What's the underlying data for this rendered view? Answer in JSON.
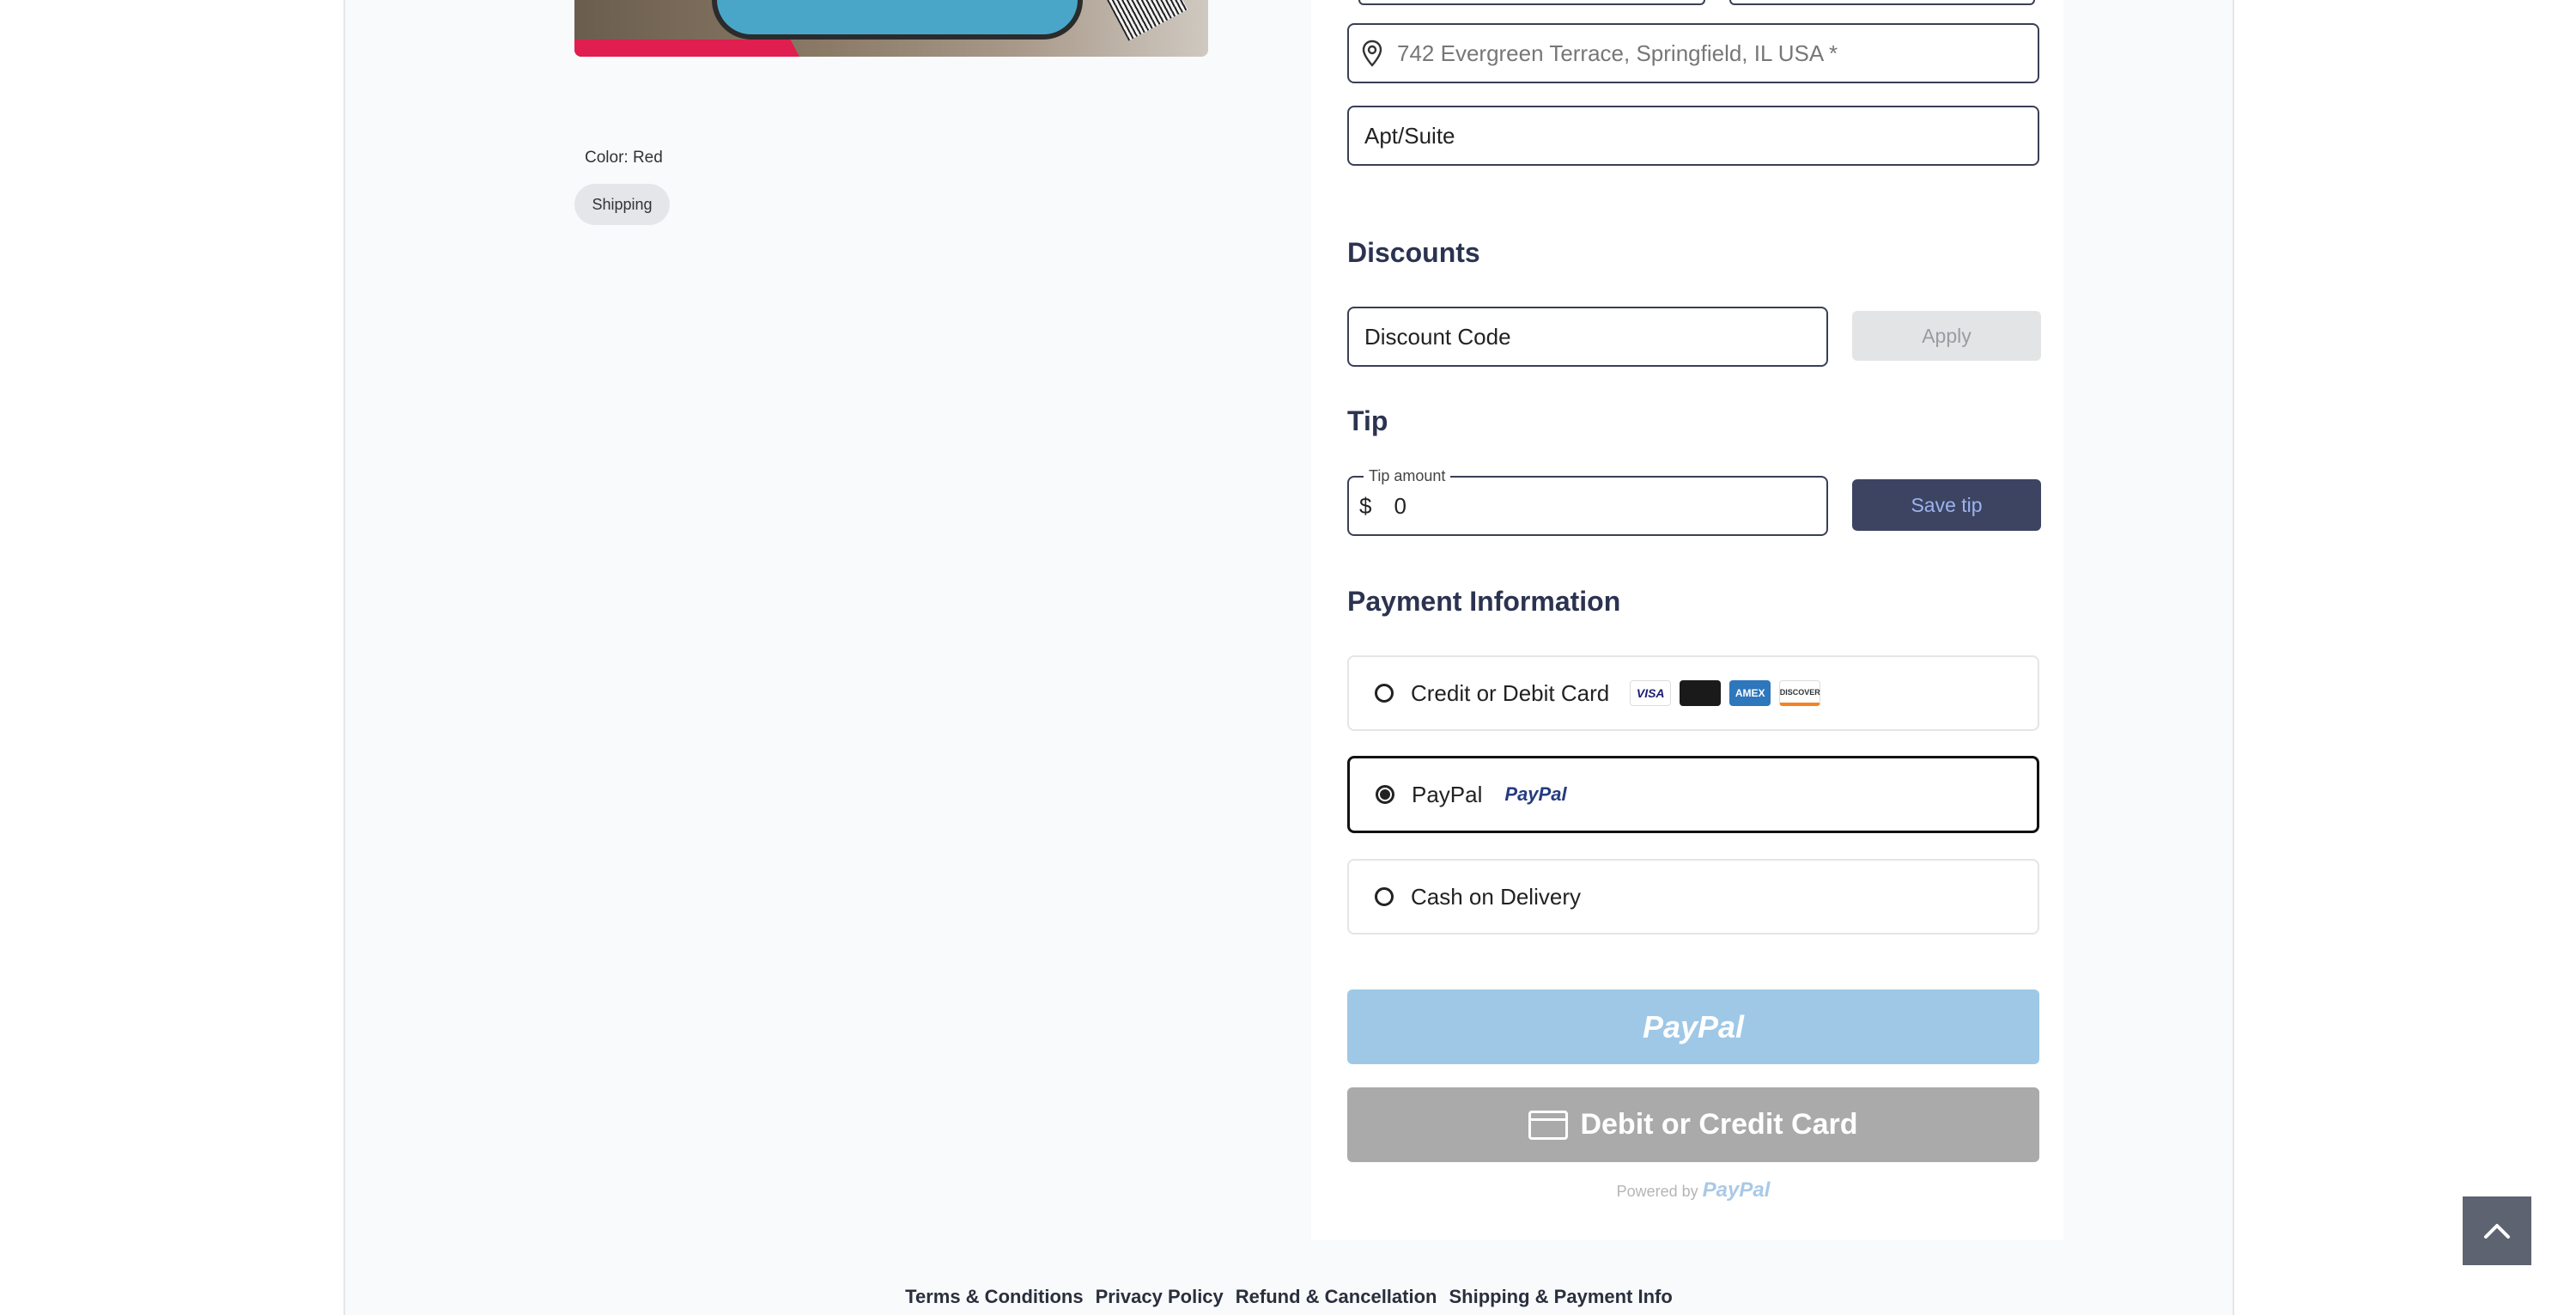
{
  "product": {
    "color_label": "Color: Red",
    "shipping_pill": "Shipping"
  },
  "address": {
    "street_placeholder": "742 Evergreen Terrace, Springfield, IL USA *",
    "apt_placeholder": "Apt/Suite"
  },
  "discounts": {
    "title": "Discounts",
    "code_placeholder": "Discount Code",
    "apply_label": "Apply"
  },
  "tip": {
    "title": "Tip",
    "field_label": "Tip amount",
    "currency": "$",
    "value": "0",
    "save_label": "Save tip"
  },
  "payment": {
    "title": "Payment Information",
    "options": [
      {
        "label": "Credit or Debit Card",
        "selected": false
      },
      {
        "label": "PayPal",
        "selected": true
      },
      {
        "label": "Cash on Delivery",
        "selected": false
      }
    ],
    "card_brands": [
      "VISA",
      "mastercard",
      "AMEX",
      "DISCOVER"
    ],
    "paypal_brand": "PayPal",
    "paypal_button_label": "PayPal",
    "card_button_label": "Debit or Credit Card",
    "powered_by": "Powered by",
    "powered_brand": "PayPal"
  },
  "footer": {
    "links": [
      "Terms & Conditions",
      "Privacy Policy",
      "Refund & Cancellation",
      "Shipping & Payment Info"
    ]
  },
  "colors": {
    "accent_dark": "#3c4461",
    "paypal_blue": "#9fc8e6",
    "sale_red": "#e01e4f"
  },
  "icons": {
    "location": "location-pin-icon",
    "scroll_top": "chevron-up-icon"
  }
}
